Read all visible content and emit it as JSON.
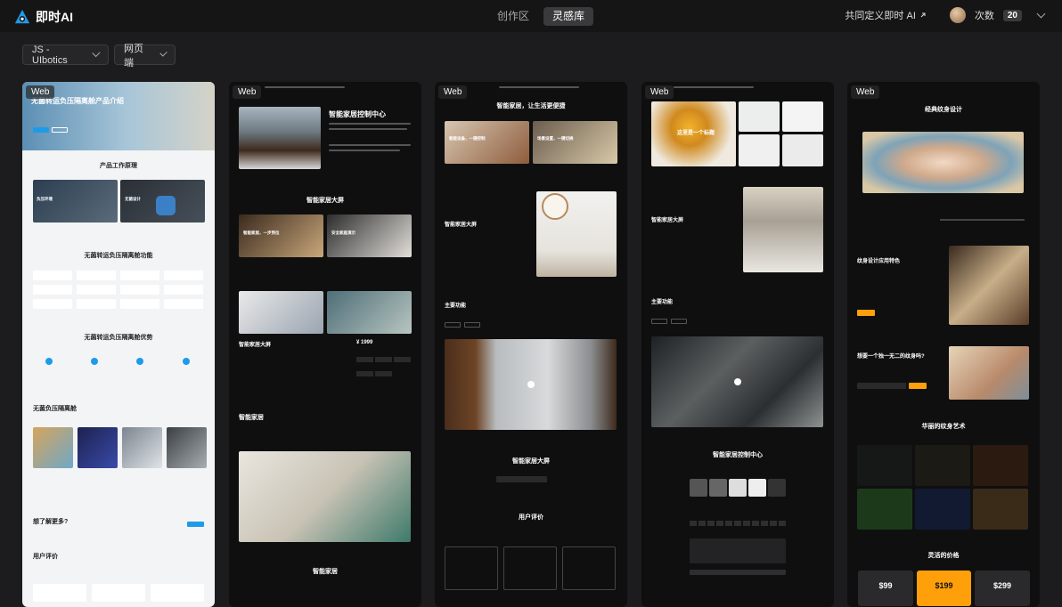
{
  "app": {
    "name": "即时AI"
  },
  "nav": {
    "tabs": [
      {
        "label": "创作区"
      },
      {
        "label": "灵感库"
      }
    ]
  },
  "header": {
    "cocreate_label": "共同定义即时 AI",
    "count_label": "次数",
    "count_value": "20"
  },
  "filters": [
    {
      "label": "JS - UIbotics"
    },
    {
      "label": "网页端"
    }
  ],
  "cards": [
    {
      "tag": "Web",
      "hero_title": "无菌转运负压隔离舱产品介绍",
      "sections": [
        "产品工作原理",
        "无菌转运负压隔离舱功能",
        "无菌转运负压隔离舱优势",
        "无菌负压隔离舱",
        "想了解更多?",
        "用户评价"
      ],
      "tiles": [
        "负压环境",
        "无菌设计"
      ]
    },
    {
      "tag": "Web",
      "sections": [
        "智能家居控制中心",
        "智能家居大屏",
        "智能家居大屏",
        "智能家居",
        "智能家居"
      ],
      "tiles": [
        "智能家居，一步到位",
        "安全家庭演示"
      ],
      "price": "¥ 1999"
    },
    {
      "tag": "Web",
      "sections": [
        "智能家居，让生活更便捷",
        "智能家居大屏",
        "主要功能",
        "智能家居大屏",
        "用户评价"
      ],
      "tiles": [
        "智能设备，一键控制",
        "场景设置，一键切换"
      ]
    },
    {
      "tag": "Web",
      "sections": [
        "智能家居大屏",
        "主要功能",
        "智能家居控制中心"
      ],
      "tiles": [
        "这里是一个标题"
      ]
    },
    {
      "tag": "Web",
      "sections": [
        "经典纹身设计",
        "纹身设计应用特色",
        "想要一个独一无二的纹身吗?",
        "华丽的纹身艺术",
        "灵活的价格"
      ],
      "prices": [
        "$99",
        "$199",
        "$299"
      ]
    }
  ],
  "colors": {
    "accent": "#ff9f0a",
    "topbar": "#151516",
    "background": "#1c1c1e",
    "light_accent": "#1e9be8"
  }
}
